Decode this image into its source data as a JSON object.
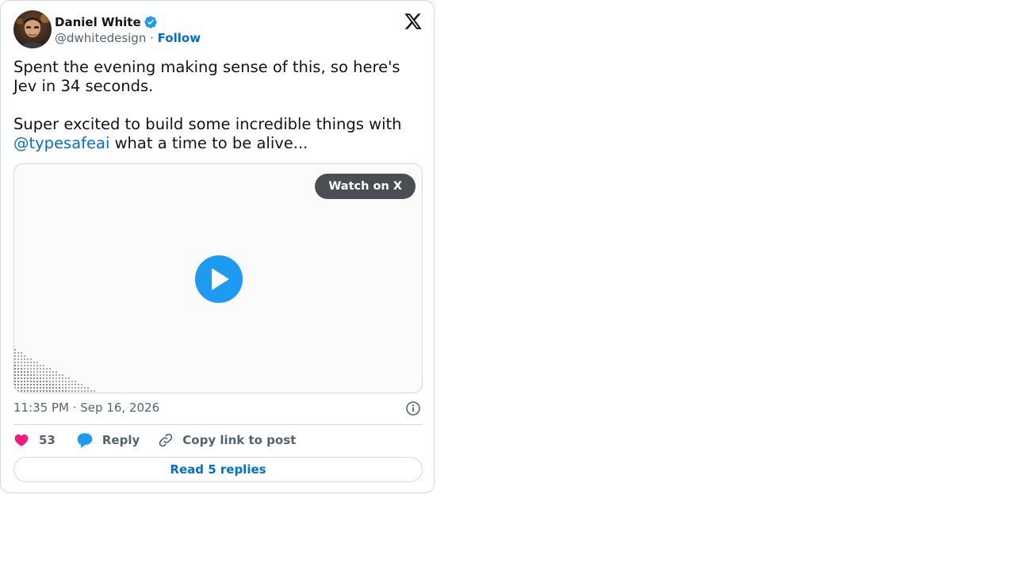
{
  "author": {
    "name": "Daniel White",
    "handle": "@dwhitedesign",
    "separator": " · ",
    "follow_label": "Follow",
    "verified": true
  },
  "tweet": {
    "paragraph_1": "Spent the evening making sense of this, so here's Jev in 34 seconds.",
    "paragraph_2_before": "Super excited to build some incredible things with ",
    "mention": "@typesafeai",
    "paragraph_2_after": " what a time to be alive..."
  },
  "media": {
    "watch_label": "Watch on X"
  },
  "meta": {
    "timestamp": "11:35 PM · Sep 16, 2026"
  },
  "actions": {
    "like_count": "53",
    "reply_label": "Reply",
    "copy_link_label": "Copy link to post"
  },
  "footer": {
    "read_replies_label": "Read 5 replies"
  },
  "colors": {
    "link": "#006fd6",
    "brand_blue": "#1d9bf0",
    "like_pink": "#f91880",
    "muted_text": "#536471",
    "border": "#cfd9de"
  },
  "icons": [
    "verified-badge-icon",
    "x-logo-icon",
    "play-icon",
    "info-icon",
    "heart-icon",
    "reply-bubble-icon",
    "link-icon"
  ]
}
